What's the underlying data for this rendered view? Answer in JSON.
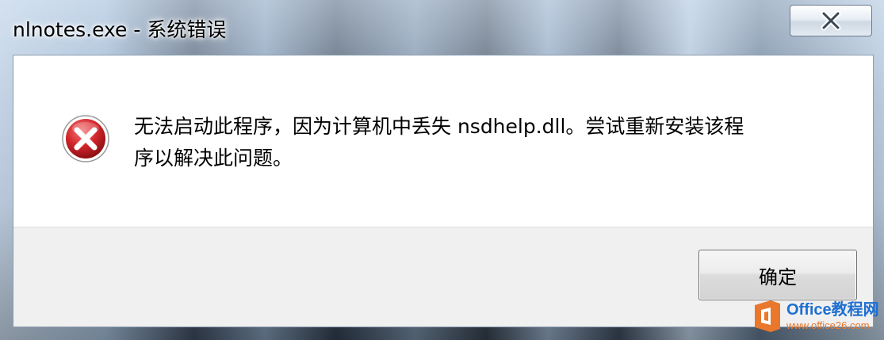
{
  "window": {
    "title": "nlnotes.exe - 系统错误"
  },
  "dialog": {
    "icon": "error-icon",
    "message_line1": "无法启动此程序，因为计算机中丢失 nsdhelp.dll。尝试重新安装该程",
    "message_line2": "序以解决此问题。",
    "ok_label": "确定"
  },
  "watermark": {
    "title": "Office教程网",
    "url": "www.office26.com"
  },
  "colors": {
    "error_red": "#d4262b",
    "client_bg": "#ffffff",
    "button_bar_bg": "#f0f0f0",
    "watermark_blue": "#1e6fd1",
    "watermark_orange": "#e9772c"
  }
}
